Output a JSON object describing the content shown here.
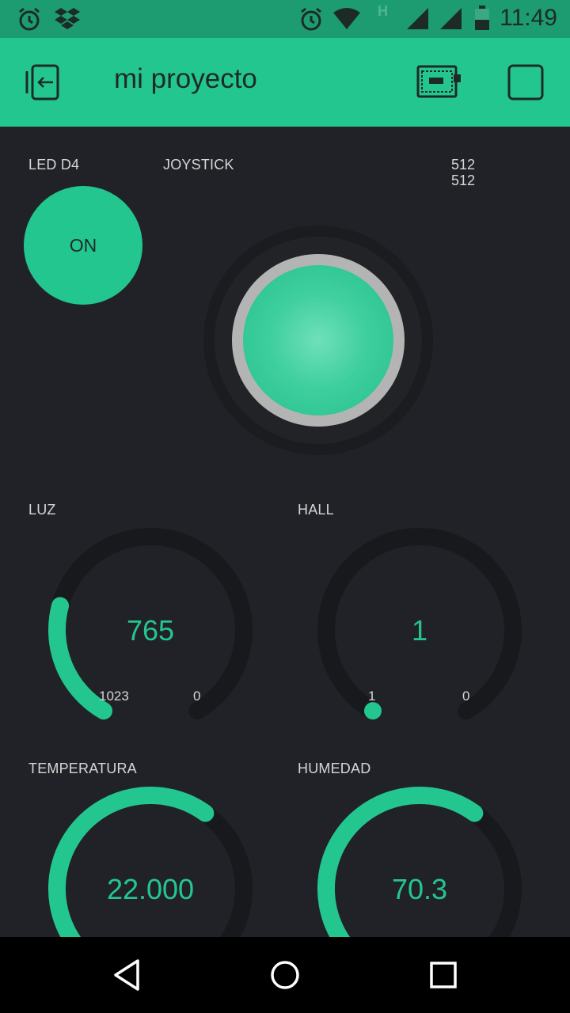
{
  "status_bar": {
    "time": "11:49",
    "icons": [
      "alarm-icon",
      "dropbox-icon",
      "alarm-icon",
      "wifi-icon",
      "signal-icon",
      "battery-icon"
    ],
    "network_type": "H"
  },
  "app_bar": {
    "title": "mi proyecto",
    "icons": [
      "exit-icon",
      "device-board-icon",
      "stop-icon"
    ]
  },
  "widgets": {
    "led": {
      "label": "LED  D4",
      "button_text": "ON"
    },
    "joystick": {
      "label": "JOYSTICK",
      "x_value": "512",
      "y_value": "512"
    },
    "luz": {
      "label": "LUZ",
      "value": "765",
      "min": "1023",
      "max": "0",
      "level": 0.25
    },
    "hall": {
      "label": "HALL",
      "value": "1",
      "min": "1",
      "max": "0",
      "level": 0.0
    },
    "temperatura": {
      "label": "TEMPERATURA",
      "value": "22.000",
      "level": 0.62
    },
    "humedad": {
      "label": "HUMEDAD",
      "value": "70.3",
      "level": 0.62
    }
  },
  "colors": {
    "accent": "#24c68f",
    "status_bar": "#1c9c70",
    "background": "#212227",
    "gauge_track": "#18191d"
  },
  "nav_bar": {
    "icons": [
      "back-icon",
      "home-icon",
      "recents-icon"
    ]
  }
}
